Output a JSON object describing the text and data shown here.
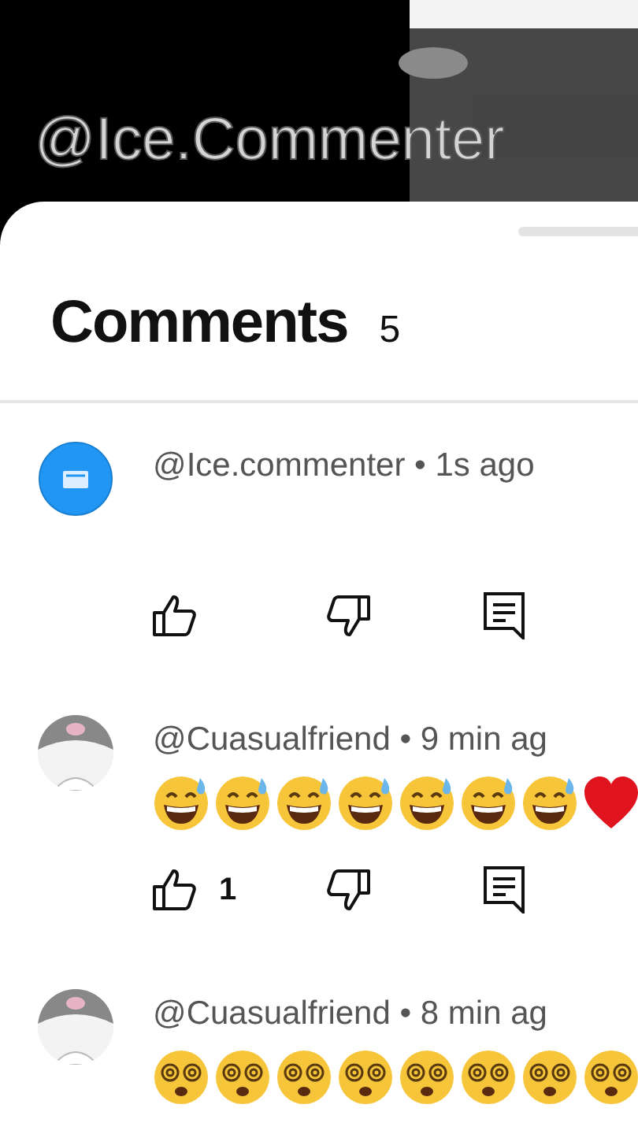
{
  "video": {
    "kind": "picture",
    "caption": "@Ice.Commenter"
  },
  "header": {
    "title": "Comments",
    "count": "5"
  },
  "comments": [
    {
      "avatar": {
        "kind": "icon"
      },
      "byline": "@Ice.commenter • 1s ago",
      "actions": true
    },
    {
      "avatar": {
        "kind": "figure"
      },
      "byline": "@Cuasualfriend • 9 min ag",
      "actions": true,
      "emojis": [
        {
          "kind": "sweat-smile"
        },
        {
          "kind": "sweat-smile"
        },
        {
          "kind": "sweat-smile"
        },
        {
          "kind": "sweat-smile"
        },
        {
          "kind": "sweat-smile"
        },
        {
          "kind": "sweat-smile"
        },
        {
          "kind": "sweat-smile"
        },
        {
          "kind": "heart"
        }
      ],
      "likes": "1"
    },
    {
      "avatar": {
        "kind": "figure"
      },
      "byline": "@Cuasualfriend • 8 min ag",
      "actions": false,
      "emojis": [
        {
          "kind": "dizzy"
        },
        {
          "kind": "dizzy"
        },
        {
          "kind": "dizzy"
        },
        {
          "kind": "dizzy"
        },
        {
          "kind": "dizzy"
        },
        {
          "kind": "dizzy"
        },
        {
          "kind": "dizzy"
        },
        {
          "kind": "dizzy"
        }
      ]
    }
  ]
}
